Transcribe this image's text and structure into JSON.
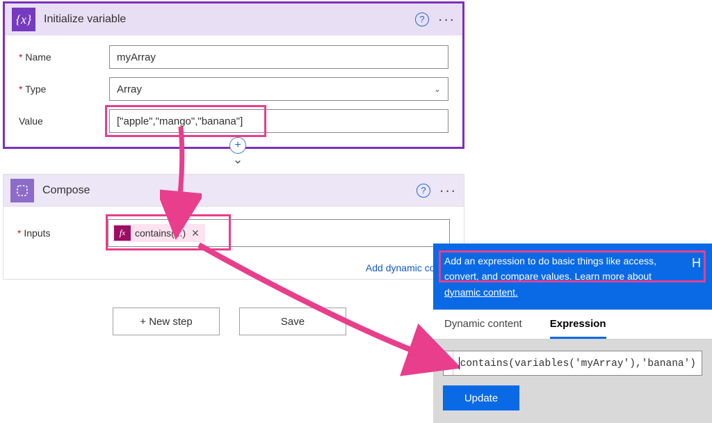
{
  "init": {
    "title": "Initialize variable",
    "name_label": "Name",
    "name_value": "myArray",
    "type_label": "Type",
    "type_value": "Array",
    "value_label": "Value",
    "value_value": "[\"apple\",\"mango\",\"banana\"]"
  },
  "compose": {
    "title": "Compose",
    "inputs_label": "Inputs",
    "pill_text": "contains(...)",
    "add_dynamic": "Add dynamic conte"
  },
  "actions": {
    "new_step": "+ New step",
    "save": "Save"
  },
  "expr_panel": {
    "hint_text": "Add an expression to do basic things like access, convert, and compare values. ",
    "learn_more": "Learn more about dynamic content.",
    "tab_dynamic": "Dynamic content",
    "tab_expression": "Expression",
    "expression": "contains(variables('myArray'),'banana')",
    "update": "Update"
  }
}
